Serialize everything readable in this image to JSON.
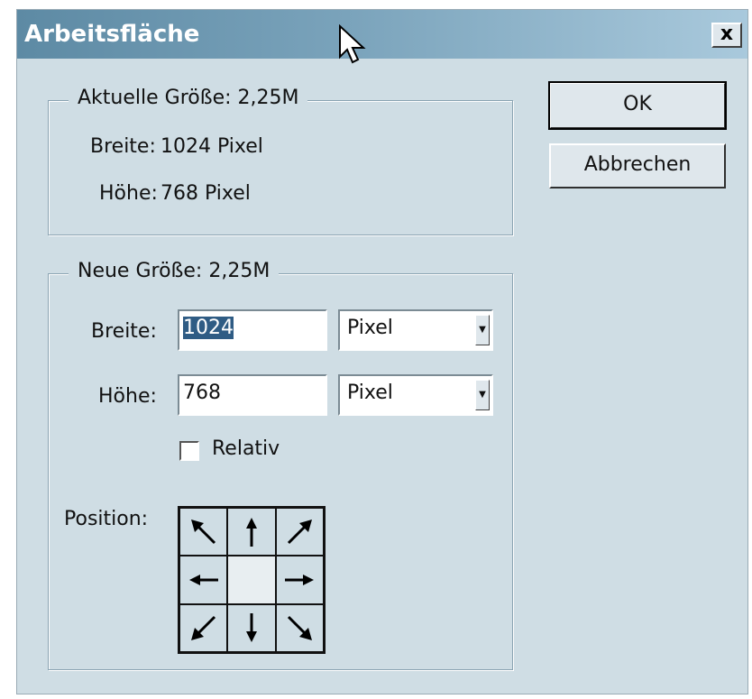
{
  "window": {
    "title": "Arbeitsfläche",
    "close_label": "x"
  },
  "current_size": {
    "legend": "Aktuelle Größe: 2,25M",
    "width_label": "Breite:",
    "width_value": "1024 Pixel",
    "height_label": "Höhe:",
    "height_value": "768 Pixel"
  },
  "new_size": {
    "legend": "Neue Größe: 2,25M",
    "width_label": "Breite:",
    "width_value": "1024",
    "width_unit": "Pixel",
    "height_label": "Höhe:",
    "height_value": "768",
    "height_unit": "Pixel",
    "relative_label": "Relativ",
    "relative_checked": false,
    "position_label": "Position:"
  },
  "buttons": {
    "ok": "OK",
    "cancel": "Abbrechen"
  },
  "anchor_grid": [
    "arrow-up-left-icon",
    "arrow-up-icon",
    "arrow-up-right-icon",
    "arrow-left-icon",
    "anchor-center",
    "arrow-right-icon",
    "arrow-down-left-icon",
    "arrow-down-icon",
    "arrow-down-right-icon"
  ],
  "colors": {
    "dialog_bg": "#cfdde4",
    "title_gradient_start": "#5d8aa4",
    "title_gradient_end": "#a9c9dc",
    "selection": "#2f5c84"
  }
}
